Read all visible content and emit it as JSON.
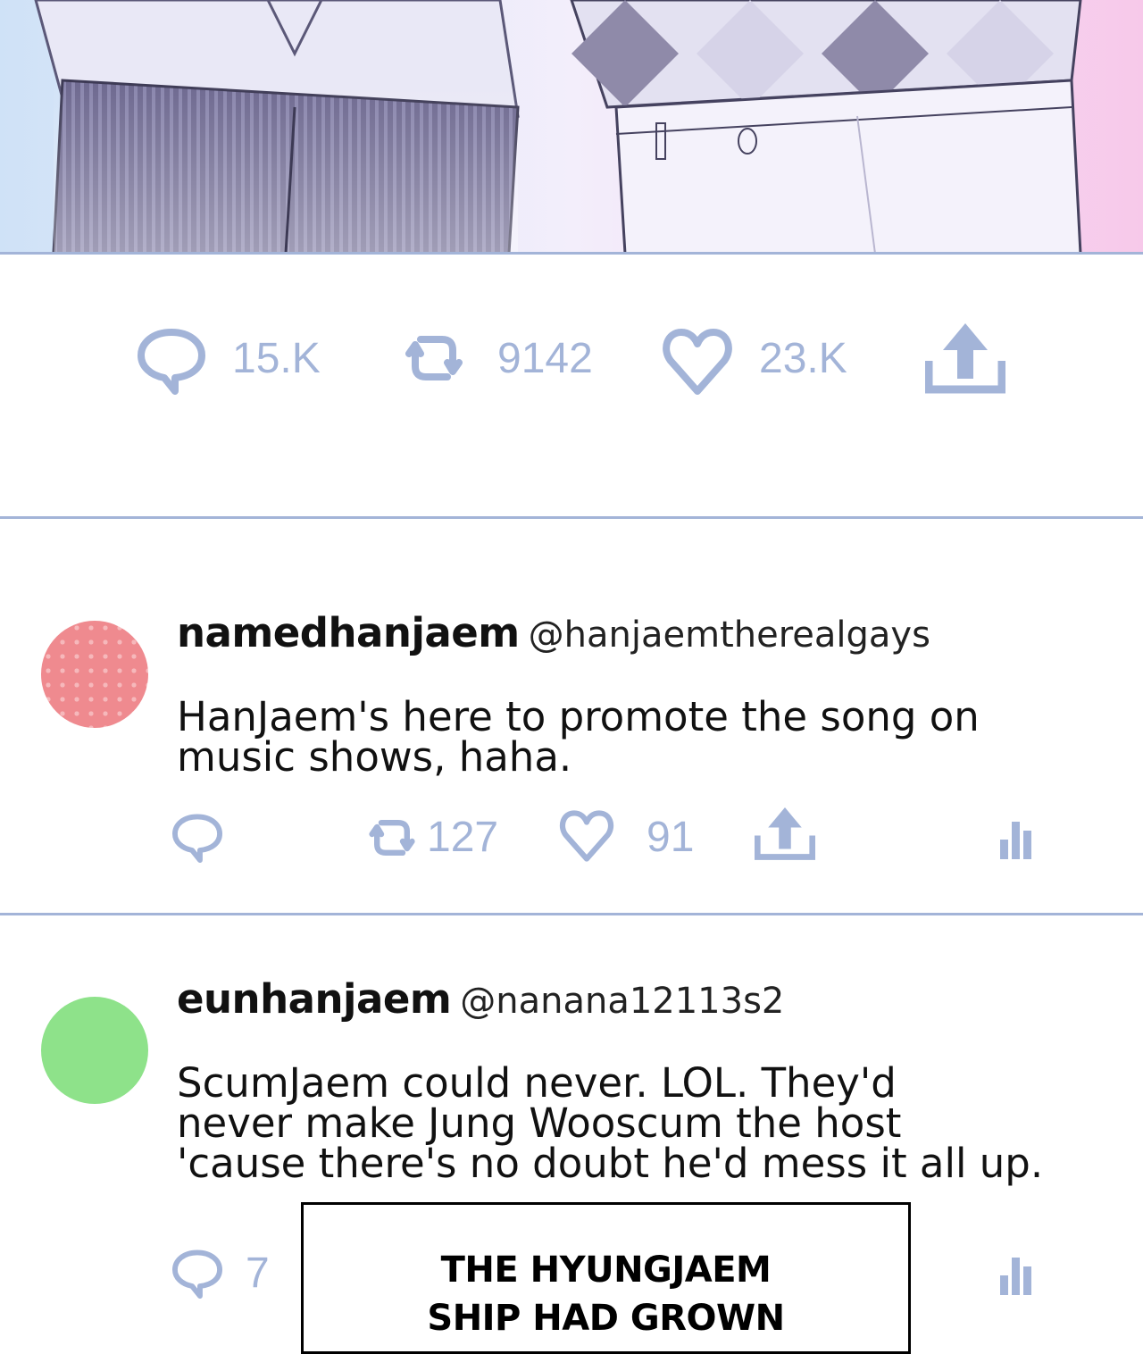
{
  "post": {
    "stats": {
      "replies": "15.K",
      "retweets": "9142",
      "likes": "23.K"
    }
  },
  "replies": [
    {
      "display_name": "namedhanjaem",
      "handle": "@hanjaemtherealgays",
      "text_lines": [
        "HanJaem's here to promote the song on",
        "music shows, haha."
      ],
      "avatar_color": "#ef8a8f",
      "stats": {
        "replies": "",
        "retweets": "127",
        "likes": "91"
      }
    },
    {
      "display_name": "eunhanjaem",
      "handle": "@nanana12113s2",
      "text_lines": [
        "ScumJaem could never. LOL. They'd",
        "never make Jung Wooscum the host",
        "'cause there's no doubt he'd mess it all up."
      ],
      "avatar_color": "#8ee28a",
      "stats": {
        "replies": "7"
      }
    }
  ],
  "caption": {
    "lines": [
      "THE HYUNGJAEM",
      "SHIP HAD GROWN"
    ]
  },
  "colors": {
    "accent": "#a3b4d8",
    "text": "#111111"
  },
  "icons": [
    "reply-icon",
    "retweet-icon",
    "heart-icon",
    "share-icon",
    "analytics-icon"
  ]
}
